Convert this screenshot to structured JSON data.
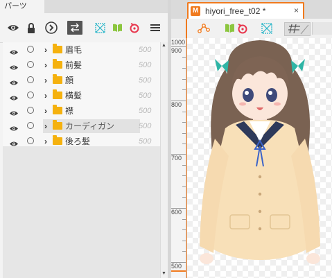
{
  "parts_panel": {
    "tab_label": "パーツ",
    "toolbar_icons": [
      "eye-icon",
      "lock-icon",
      "arrow-circle-icon",
      "swap-icon",
      "deformer-icon",
      "warp-icon",
      "rotate-icon",
      "menu-icon"
    ],
    "rows": [
      {
        "label": "眉毛",
        "value": "500",
        "selected": false
      },
      {
        "label": "前髪",
        "value": "500",
        "selected": false
      },
      {
        "label": "顔",
        "value": "500",
        "selected": false
      },
      {
        "label": "横髪",
        "value": "500",
        "selected": false
      },
      {
        "label": "襟",
        "value": "500",
        "selected": false
      },
      {
        "label": "カーディガン",
        "value": "500",
        "selected": true
      },
      {
        "label": "後ろ髪",
        "value": "500",
        "selected": false
      }
    ]
  },
  "canvas_panel": {
    "tab_icon": "M",
    "tab_title": "hiyori_free_t02 *",
    "tab_close": "×",
    "toolbar_icons": [
      "mesh-icon",
      "warp-icon",
      "rotate-icon",
      "deformer-icon",
      "grid-icon"
    ],
    "ruler_labels": [
      "1000",
      "900",
      "800",
      "700",
      "600",
      "500"
    ]
  },
  "colors": {
    "accent": "#f07a1e",
    "folder": "#f5b10e",
    "deformer": "#2ab6c9",
    "warp": "#8cc63f",
    "rotate": "#e8364d"
  }
}
